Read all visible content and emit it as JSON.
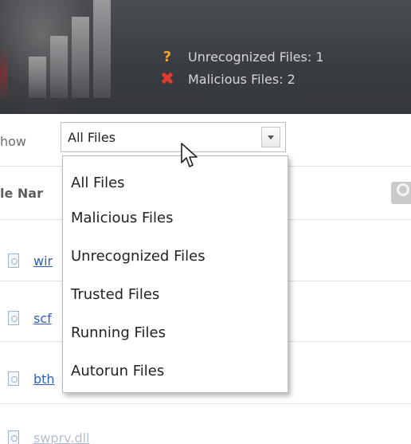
{
  "banner": {
    "stats": [
      {
        "icon": "question-icon",
        "glyph": "?",
        "color": "#f2a532",
        "label": "Unrecognized Files: 1"
      },
      {
        "icon": "close-x-icon",
        "glyph": "✖",
        "color": "#e53a2f",
        "label": "Malicious Files: 2"
      }
    ]
  },
  "filter": {
    "label": "how",
    "selected": "All Files",
    "options": [
      "All Files",
      "Malicious Files",
      "Unrecognized Files",
      "Trusted Files",
      "Running Files",
      "Autorun Files"
    ]
  },
  "table": {
    "column_header": "le Nar",
    "files": [
      "wir",
      "scf",
      "bth",
      "swprv.dll"
    ]
  }
}
